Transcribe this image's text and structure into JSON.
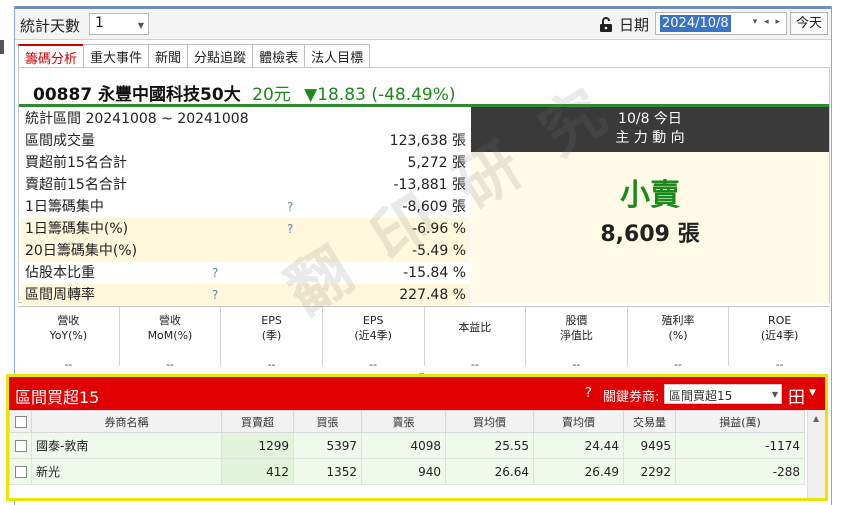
{
  "toolbar": {
    "days_label": "統計天數",
    "days_value": "1",
    "date_label": "日期",
    "date_value": "2024/10/8",
    "today_label": "今天"
  },
  "tabs": [
    "籌碼分析",
    "重大事件",
    "新聞",
    "分點追蹤",
    "體檢表",
    "法人目標"
  ],
  "stock": {
    "code_name": "00887 永豐中國科技50大",
    "price": "20元",
    "change": "▼18.83 (-48.49%)"
  },
  "stats": [
    {
      "label": "統計區間  20241008 ~ 20241008",
      "value": "",
      "q": false
    },
    {
      "label": "區間成交量",
      "value": "123,638 張",
      "q": false
    },
    {
      "label": "買超前15名合計",
      "value": "5,272 張",
      "q": false
    },
    {
      "label": "賣超前15名合計",
      "value": "-13,881 張",
      "q": false
    },
    {
      "label": "1日籌碼集中",
      "value": "-8,609 張",
      "q": true
    },
    {
      "label": "1日籌碼集中(%)",
      "value": "-6.96 %",
      "q": true
    },
    {
      "label": "20日籌碼集中(%)",
      "value": "-5.49 %",
      "q": false
    },
    {
      "label": "佔股本比重",
      "value": "-15.84 %",
      "q": true
    },
    {
      "label": "區間周轉率",
      "value": "227.48 %",
      "q": true
    }
  ],
  "main_force": {
    "date_title": "10/8 今日",
    "subtitle": "主 力 動 向",
    "direction": "小賣",
    "amount": "8,609 張"
  },
  "watermark": "翻 印 研 究",
  "metrics": [
    {
      "l1": "營收",
      "l2": "YoY(%)",
      "v": "--"
    },
    {
      "l1": "營收",
      "l2": "MoM(%)",
      "v": "--"
    },
    {
      "l1": "EPS",
      "l2": "(季)",
      "v": "--"
    },
    {
      "l1": "EPS",
      "l2": "(近4季)",
      "v": "--"
    },
    {
      "l1": "本益比",
      "l2": "",
      "v": "--"
    },
    {
      "l1": "股價",
      "l2": "淨值比",
      "v": "--"
    },
    {
      "l1": "殖利率",
      "l2": "(%)",
      "v": "--"
    },
    {
      "l1": "ROE",
      "l2": "(近4季)",
      "v": "--"
    }
  ],
  "broker_panel": {
    "title": "區間買超15",
    "help": "?",
    "key_broker_label": "關鍵券商:",
    "key_broker_value": "區間買超15",
    "columns": [
      "券商名稱",
      "買賣超",
      "買張",
      "賣張",
      "買均價",
      "賣均價",
      "交易量",
      "損益(萬)"
    ],
    "rows": [
      [
        "國泰-敦南",
        "1299",
        "5397",
        "4098",
        "25.55",
        "24.44",
        "9495",
        "-1174"
      ],
      [
        "新光",
        "412",
        "1352",
        "940",
        "26.64",
        "26.49",
        "2292",
        "-288"
      ]
    ]
  }
}
